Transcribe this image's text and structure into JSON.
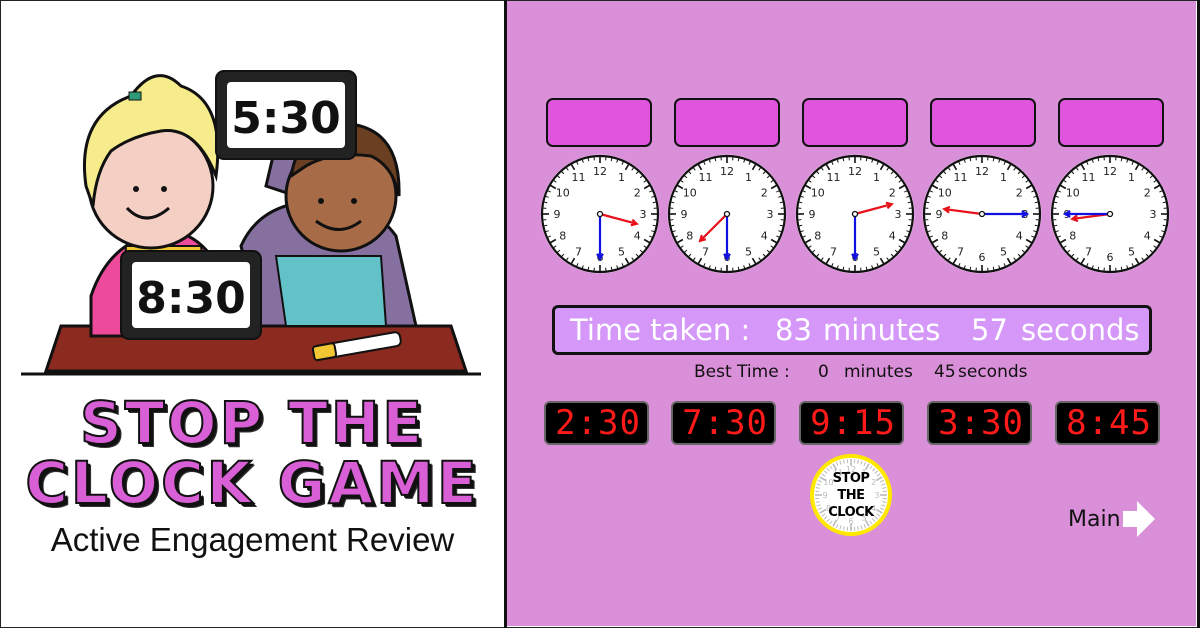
{
  "promo": {
    "title_line1": "STOP THE",
    "title_line2": "CLOCK GAME",
    "subtitle": "Active Engagement Review",
    "illustration": {
      "card_girl": "8:30",
      "card_boy": "5:30"
    }
  },
  "game": {
    "answer_boxes": [
      "",
      "",
      "",
      "",
      ""
    ],
    "analog_clocks": [
      {
        "time": "3:30",
        "hour": 3,
        "minute": 30
      },
      {
        "time": "7:30",
        "hour": 7,
        "minute": 30
      },
      {
        "time": "2:30",
        "hour": 2,
        "minute": 30
      },
      {
        "time": "9:15",
        "hour": 9,
        "minute": 15
      },
      {
        "time": "8:45",
        "hour": 8,
        "minute": 45
      }
    ],
    "clock_numbers": [
      "12",
      "1",
      "2",
      "3",
      "4",
      "5",
      "6",
      "7",
      "8",
      "9",
      "10",
      "11"
    ],
    "timer": {
      "label": "Time taken :",
      "minutes": "83",
      "minutes_unit": "minutes",
      "seconds": "57",
      "seconds_unit": "seconds"
    },
    "best_time": {
      "label": "Best Time :",
      "minutes": "0",
      "minutes_unit": "minutes",
      "seconds": "45",
      "seconds_unit": "seconds"
    },
    "digital_times": [
      "2:30",
      "7:30",
      "9:15",
      "3:30",
      "8:45"
    ],
    "stop_button": {
      "line1": "STOP",
      "line2": "THE",
      "line3": "CLOCK"
    },
    "main_button": "Main",
    "colors": {
      "background": "#da8fd9",
      "answer_box": "#df55de",
      "timer_bg": "#d598f9",
      "hour_hand": "#e8101a",
      "minute_hand": "#1010e0",
      "digital_text": "#ff1a1a",
      "stop_ring": "#ffe800"
    }
  }
}
